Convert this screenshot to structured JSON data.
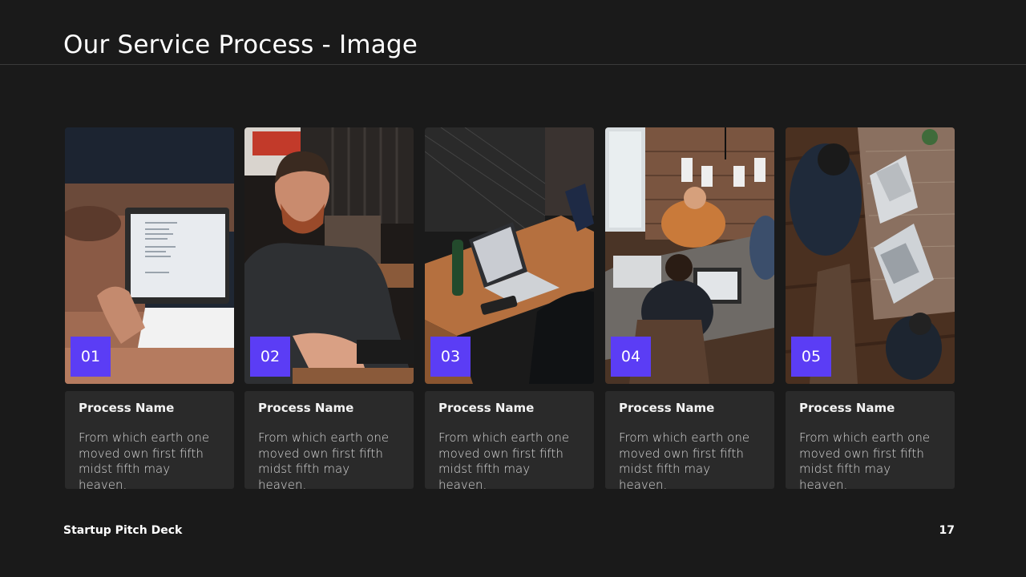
{
  "slide": {
    "title": "Our Service Process - Image",
    "footer_left": "Startup Pitch Deck",
    "page_number": "17"
  },
  "accent_color": "#5b3df5",
  "steps": [
    {
      "number": "01",
      "title": "Process Name",
      "description": "From which earth one moved own first fifth midst fifth may heaven.",
      "image": "person-typing-on-laptop-photo"
    },
    {
      "number": "02",
      "title": "Process Name",
      "description": "From which earth one moved own first fifth midst fifth may heaven.",
      "image": "bearded-man-at-keyboard-photo"
    },
    {
      "number": "03",
      "title": "Process Name",
      "description": "From which earth one moved own first fifth midst fifth may heaven.",
      "image": "laptops-on-wooden-desk-photo"
    },
    {
      "number": "04",
      "title": "Process Name",
      "description": "From which earth one moved own first fifth midst fifth may heaven.",
      "image": "team-meeting-at-table-photo"
    },
    {
      "number": "05",
      "title": "Process Name",
      "description": "From which earth one moved own first fifth midst fifth may heaven.",
      "image": "overhead-laptops-table-photo"
    }
  ]
}
